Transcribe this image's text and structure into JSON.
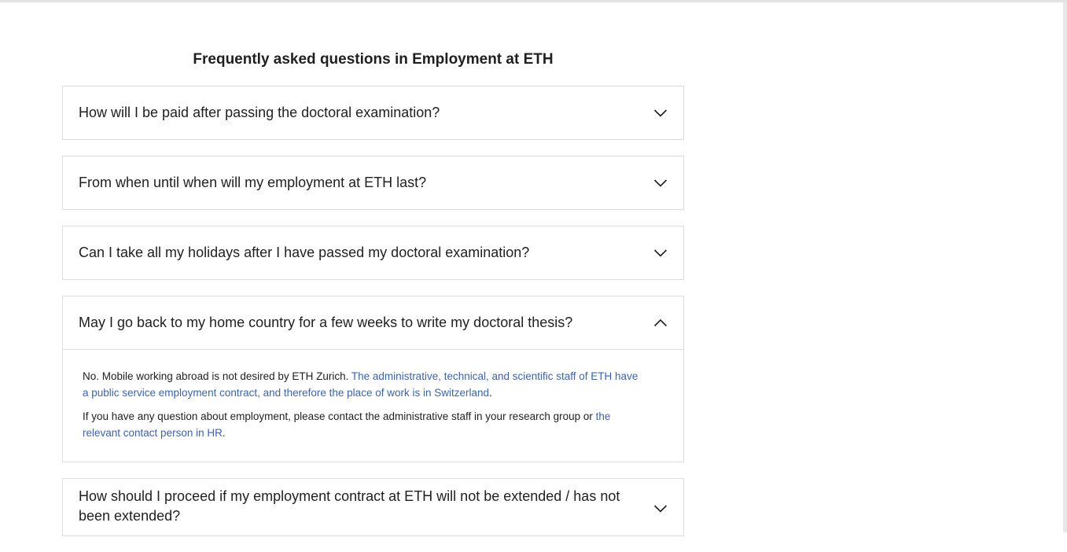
{
  "faq": {
    "title": "Frequently asked questions in Employment at ETH",
    "items": [
      {
        "question": "How will I be paid after passing the doctoral examination?",
        "expanded": false
      },
      {
        "question": "From when until when will my employment at ETH last?",
        "expanded": false
      },
      {
        "question": "Can I take all my holidays after I have passed my doctoral examination?",
        "expanded": false
      },
      {
        "question": "May I go back to my home country for a few weeks to write my doctoral thesis?",
        "expanded": true,
        "answer": {
          "p1_text": "No. Mobile working abroad is not desired by ETH Zurich. ",
          "p1_link": "The administrative, technical, and scientific staff of ETH have a public service employment contract, and therefore the place of work is in Switzerland",
          "p1_end": ".",
          "p2_text": "If you have any question about employment, please contact the administrative staff in your research group or ",
          "p2_link": "the relevant contact person in HR",
          "p2_end": "."
        }
      },
      {
        "question": "How should I proceed if my employment contract at ETH will not be extended / has not been extended?",
        "expanded": false
      }
    ]
  },
  "icons": {
    "collapsed": "chevron-down-icon",
    "expanded": "chevron-up-icon"
  },
  "colors": {
    "link": "#3d64a8",
    "border": "#dcdcdc",
    "text": "#1f1f1f"
  }
}
